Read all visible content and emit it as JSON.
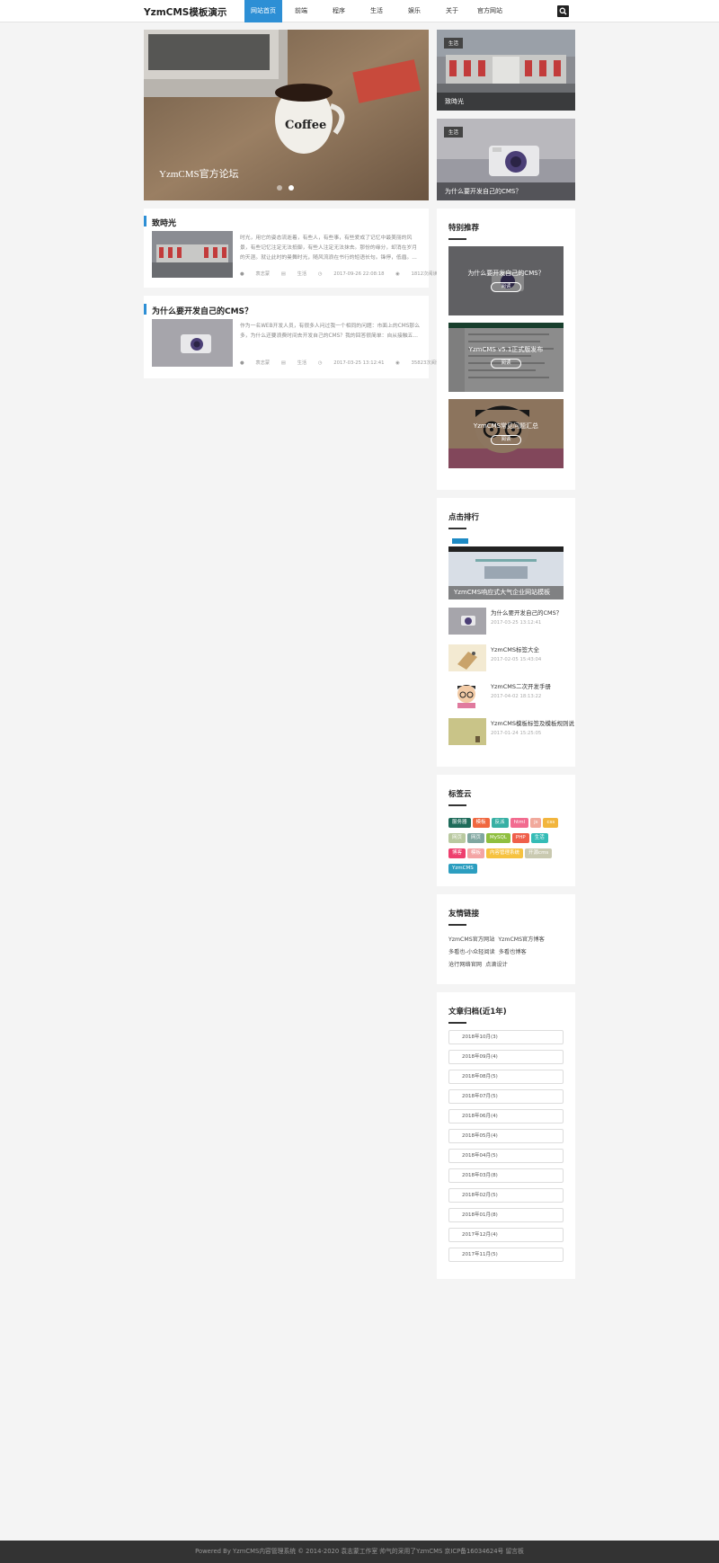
{
  "header": {
    "logo": "YzmCMS模板演示",
    "nav": [
      "网站首页",
      "前端",
      "程序",
      "生活",
      "娱乐",
      "关于",
      "官方网站"
    ],
    "active_nav": "网站首页"
  },
  "slider": {
    "caption": "YzmCMS官方论坛",
    "dots": 2,
    "active_dot": 2
  },
  "top_cards": [
    {
      "badge": "生活",
      "title": "致時光"
    },
    {
      "badge": "生活",
      "title": "为什么要开发自己的CMS？"
    }
  ],
  "articles": [
    {
      "title": "致時光",
      "desc": "时光，用它的姿态流逝着，有些人，有些事，有些爱成了记忆中最美丽的风景，有些记忆注定无法抵御，有些人注定无法抹去。那份的缘分，却消在岁月的天涯。就让此时的曼舞时光，随风流浪在书行的短语长句。锋停，低眉。...",
      "author": "袁志蒙",
      "category": "生活",
      "time": "2017-09-26 22:08:18",
      "views": "1812次阅读"
    },
    {
      "title": "为什么要开发自己的CMS？",
      "desc": "作为一名WEB开发人员，有很多人问过我一个相同的问题：市面上的CMS那么多，为什么还要浪费时间去开发自己的CMS？我的回答很简单：自从接触五...",
      "author": "袁志蒙",
      "category": "生活",
      "time": "2017-03-25 13:12:41",
      "views": "35823次阅读"
    }
  ],
  "recommend": {
    "title": "特别推荐",
    "items": [
      {
        "title": "为什么要开发自己的CMS？",
        "button": "阅读"
      },
      {
        "title": "YzmCMS v5.1正式版发布",
        "button": "阅读"
      },
      {
        "title": "YzmCMS常见问题汇总",
        "button": "阅读"
      }
    ]
  },
  "ranking": {
    "title": "点击排行",
    "featured": "YzmCMS响应式大气企业网站模板",
    "items": [
      {
        "title": "为什么要开发自己的CMS？",
        "date": "2017-03-25 13:12:41"
      },
      {
        "title": "YzmCMS标签大全",
        "date": "2017-02-05 15:43:04"
      },
      {
        "title": "YzmCMS二次开发手册",
        "date": "2017-04-02 18:13:22"
      },
      {
        "title": "YzmCMS模板标签及模板规则说",
        "date": "2017-01-24 15:25:05"
      }
    ]
  },
  "tagcloud": {
    "title": "标签云",
    "tags": [
      {
        "label": "服务器",
        "color": "#1e6b5a"
      },
      {
        "label": "模板",
        "color": "#f0673f"
      },
      {
        "label": "反派",
        "color": "#37b0a4"
      },
      {
        "label": "html",
        "color": "#f26b8f"
      },
      {
        "label": "js",
        "color": "#f1a99c"
      },
      {
        "label": "css",
        "color": "#f2b53d"
      },
      {
        "label": "网页",
        "color": "#b9c9a0"
      },
      {
        "label": "网页",
        "color": "#80a7a0"
      },
      {
        "label": "MySQL",
        "color": "#8fbf3f"
      },
      {
        "label": "PHP",
        "color": "#ef5f4a"
      },
      {
        "label": "生活",
        "color": "#35bcb6"
      },
      {
        "label": "博客",
        "color": "#ee3f6e"
      },
      {
        "label": "模板",
        "color": "#f4a4a4"
      },
      {
        "label": "内容管理系统",
        "color": "#f6c23f"
      },
      {
        "label": "开源cms",
        "color": "#c9c9b0"
      },
      {
        "label": "YzmCMS",
        "color": "#2c9ec0"
      }
    ]
  },
  "friend_links": {
    "title": "友情链接",
    "links": [
      "YzmCMS官方网站",
      "YzmCMS官方博客",
      "多看也-小众轻阅读",
      "多看也博客",
      "沧行网络官网",
      "点滴设计"
    ]
  },
  "archive": {
    "title": "文章归档(近1年)",
    "items": [
      "2018年10月(3)",
      "2018年09月(4)",
      "2018年08月(5)",
      "2018年07月(5)",
      "2018年06月(4)",
      "2018年05月(4)",
      "2018年04月(5)",
      "2018年03月(8)",
      "2018年02月(5)",
      "2018年01月(8)",
      "2017年12月(4)",
      "2017年11月(5)"
    ]
  },
  "footer": {
    "text": "Powered By YzmCMS内容管理系统 © 2014-2020 袁志蒙工作室 帅气的采用了YzmCMS 京ICP备16034624号 留言板"
  }
}
